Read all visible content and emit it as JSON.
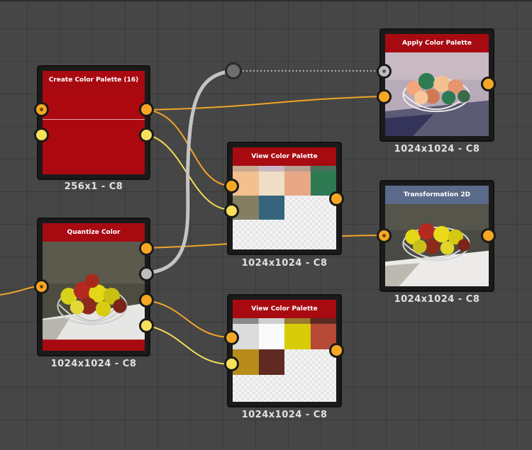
{
  "nodes": {
    "create_palette": {
      "title": "Create Color Palette (16)",
      "resolution": "256x1 - C8"
    },
    "quantize": {
      "title": "Quantize Color",
      "resolution": "1024x1024 - C8"
    },
    "view_palette_1": {
      "title": "View Color Palette",
      "resolution": "1024x1024 - C8",
      "swatch_colors": [
        "#f2c18f",
        "#efdec6",
        "#e8a887",
        "#2d7a52",
        "#847e63",
        "#35647c"
      ]
    },
    "view_palette_2": {
      "title": "View Color Palette",
      "resolution": "1024x1024 - C8",
      "swatch_colors": [
        "#dcdcdc",
        "#fafafa",
        "#d8cc08",
        "#b64a36",
        "#b78c1a",
        "#5e2a22"
      ]
    },
    "apply_palette": {
      "title": "Apply Color Palette",
      "resolution": "1024x1024 - C8"
    },
    "transformation": {
      "title": "Transformation 2D",
      "resolution": "1024x1024 - C8"
    }
  },
  "colors": {
    "canvas": "#464646",
    "node_header_red": "#a80a11",
    "node_header_blue": "#5a6a8a",
    "wire_orange": "#f0a42a",
    "wire_yellow": "#f2dc56",
    "wire_gray": "#c4c4c4"
  }
}
